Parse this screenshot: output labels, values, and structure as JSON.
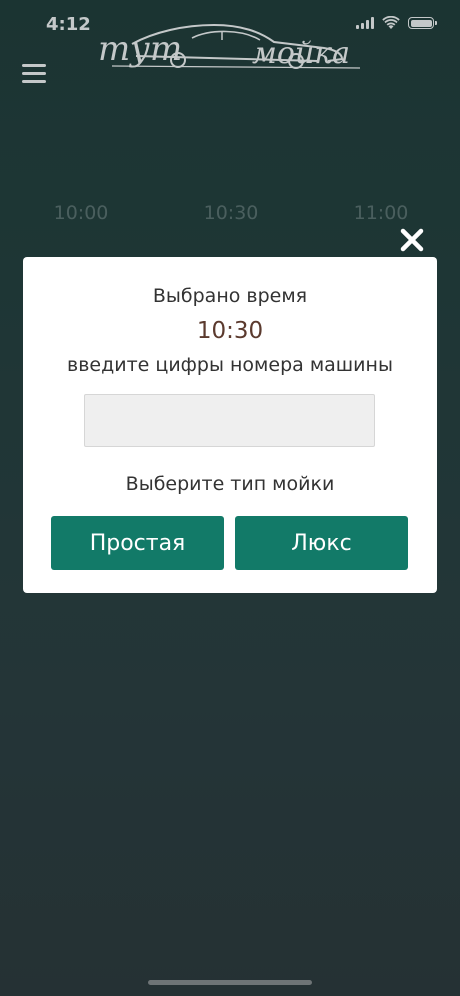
{
  "status_bar": {
    "time": "4:12"
  },
  "header": {
    "logo_left": "тут",
    "logo_right": "мойка"
  },
  "schedule": {
    "rows": [
      [
        "10:00",
        "10:30",
        "11:00"
      ],
      [
        "",
        "",
        ""
      ],
      [
        "",
        "",
        ""
      ],
      [
        "",
        "",
        ""
      ],
      [
        "",
        "",
        ""
      ],
      [
        "",
        "",
        ""
      ],
      [
        "",
        "",
        ""
      ],
      [
        "",
        "",
        ""
      ],
      [
        "",
        "",
        ""
      ],
      [
        "",
        "",
        ""
      ]
    ]
  },
  "modal": {
    "title": "Выбрано время",
    "selected_time": "10:30",
    "prompt": "введите цифры номера машины",
    "plate_input_value": "",
    "wash_type_label": "Выберите тип мойки",
    "buttons": {
      "simple": "Простая",
      "lux": "Люкс"
    }
  },
  "colors": {
    "accent": "#127a68",
    "time_text": "#5b3a2e",
    "background": "#233d3b"
  }
}
